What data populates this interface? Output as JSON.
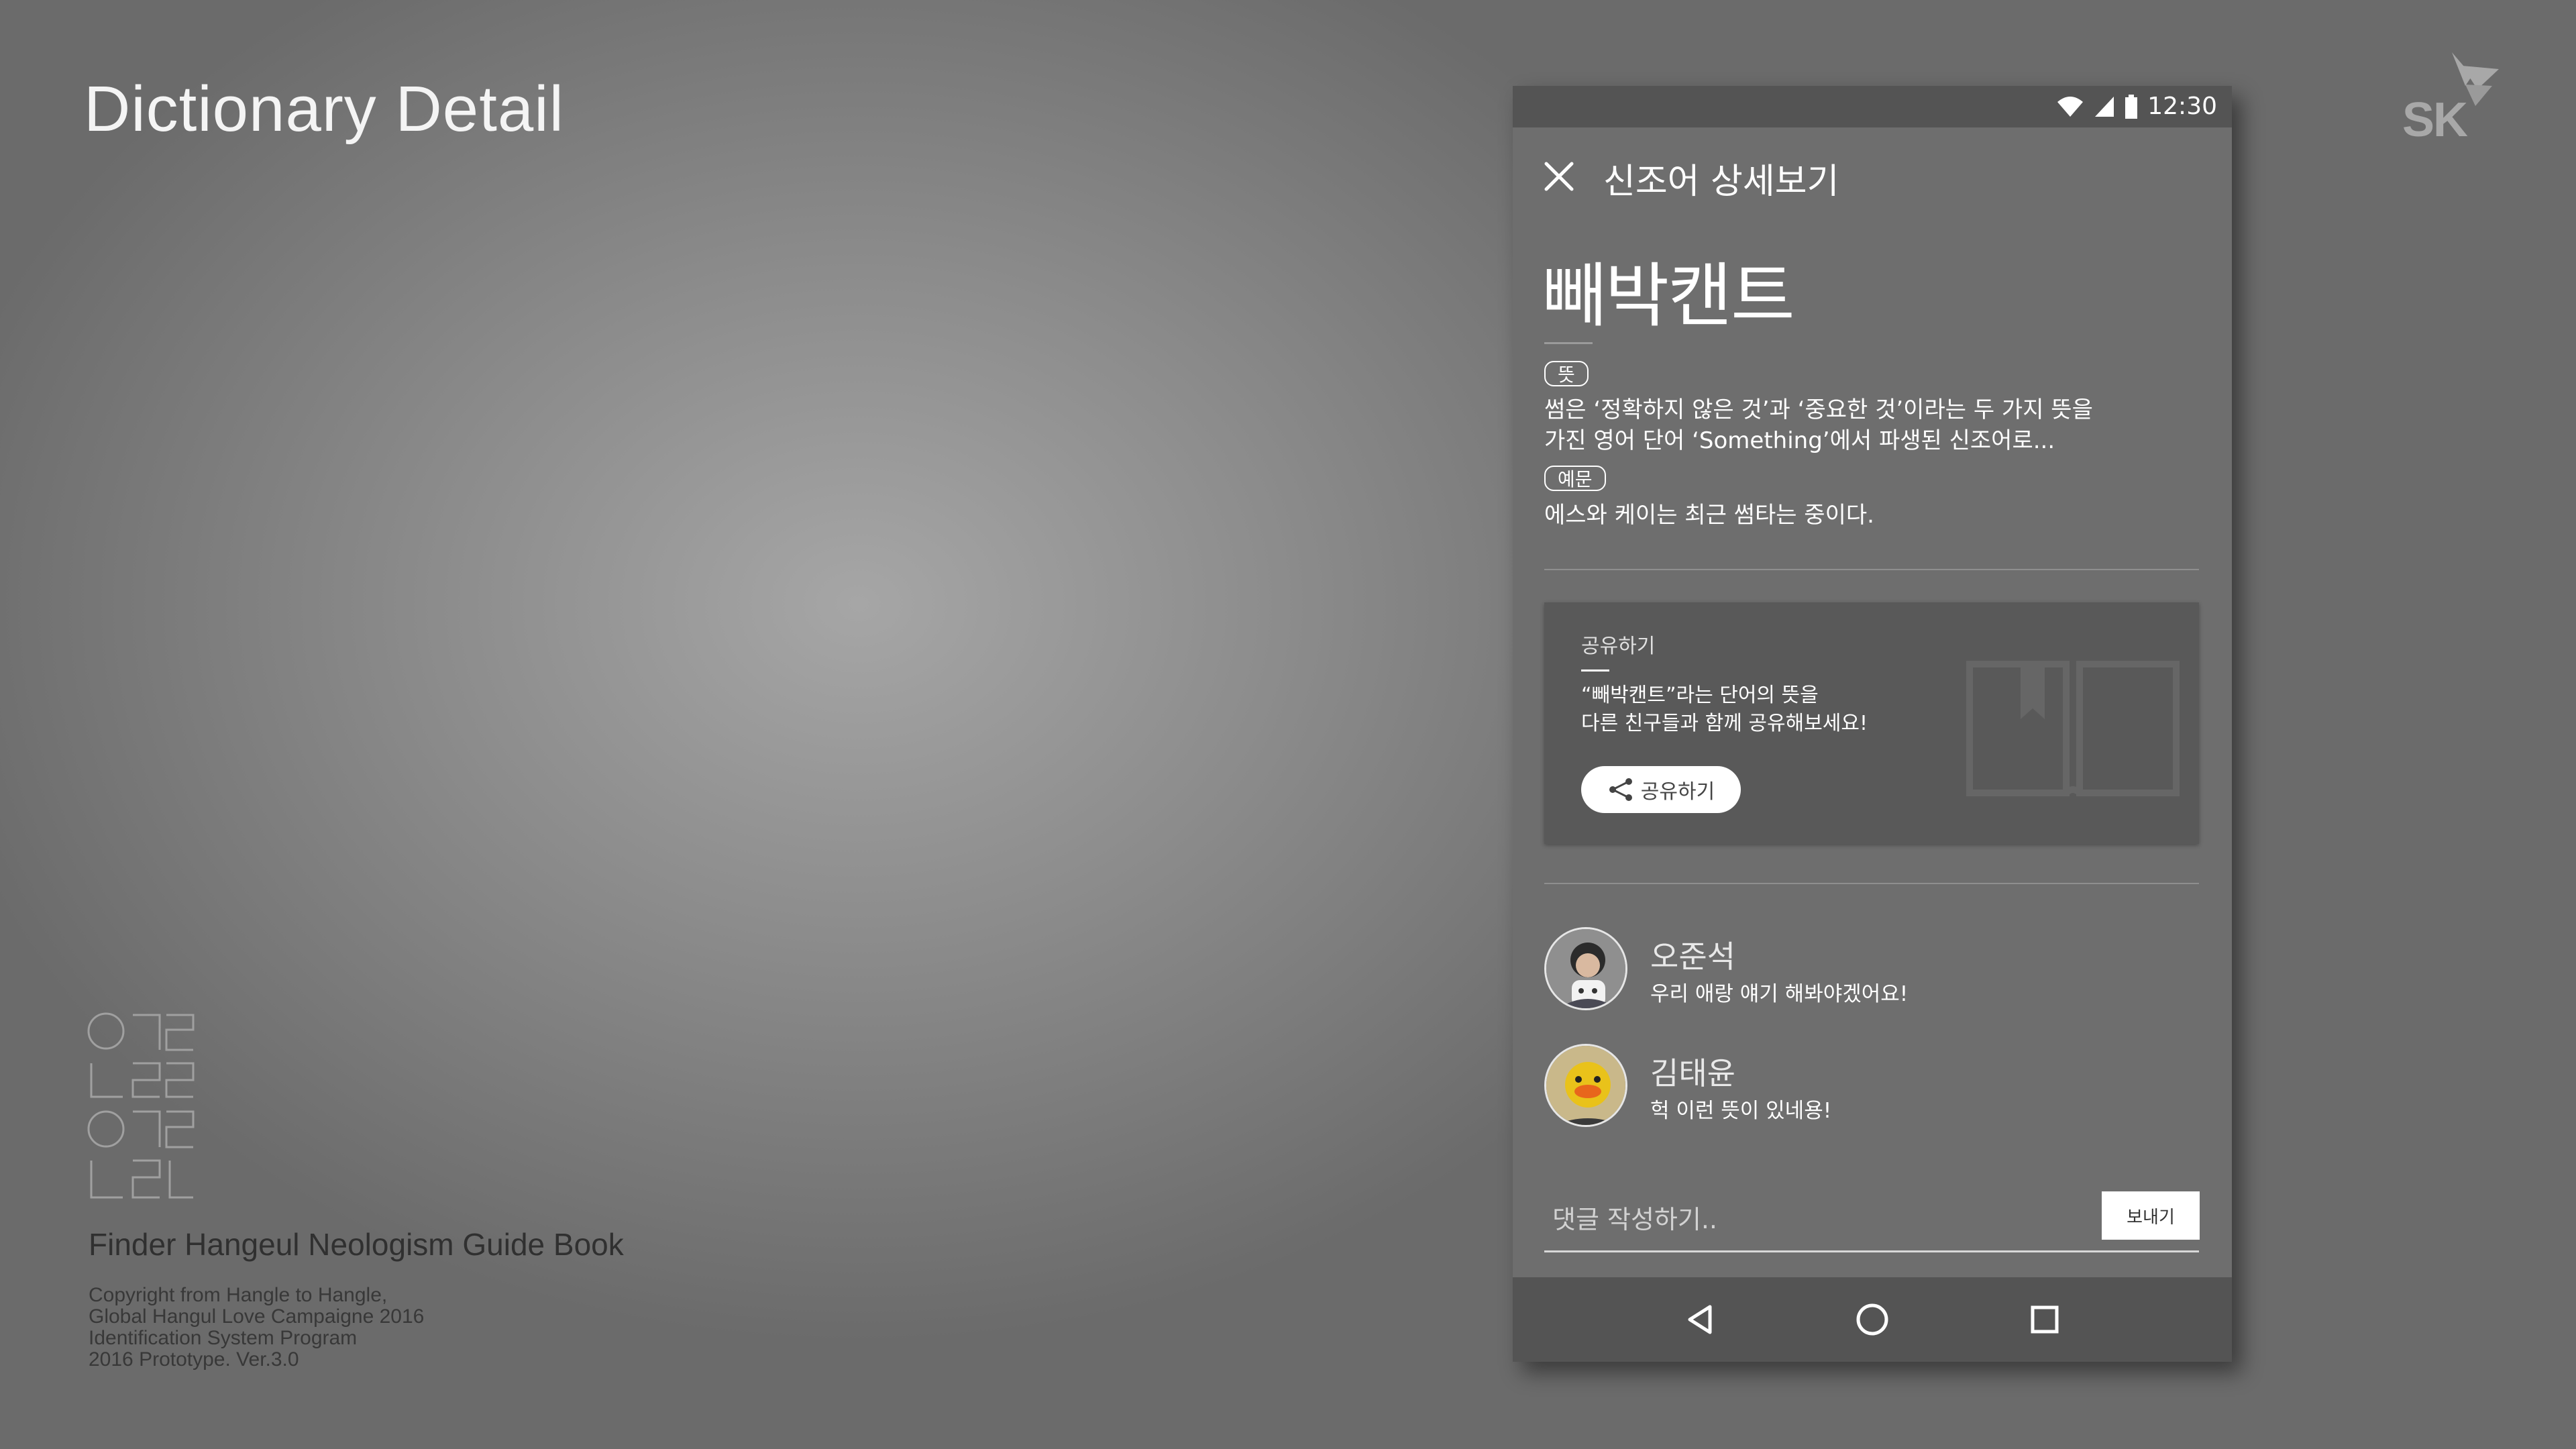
{
  "page": {
    "title": "Dictionary Detail",
    "brand": "SK",
    "book_title": "Finder Hangeul Neologism Guide Book",
    "copyright_lines": [
      "Copyright from Hangle to Hangle,",
      "Global Hangul Love Campaigne 2016",
      "Identification System Program",
      "2016 Prototype. Ver.3.0"
    ],
    "hangul_logo": "한글 한글"
  },
  "phone": {
    "status": {
      "time": "12:30",
      "icons": [
        "wifi-icon",
        "signal-icon",
        "battery-icon"
      ]
    },
    "header": {
      "title": "신조어 상세보기",
      "close_icon": "close-icon"
    },
    "entry": {
      "word": "빼박캔트",
      "meaning_tag": "뜻",
      "meaning_lines": [
        "썸은 ‘정확하지 않은 것’과 ‘중요한 것’이라는 두 가지 뜻을",
        "가진 영어 단어 ‘Something’에서 파생된 신조어로..."
      ],
      "example_tag": "예문",
      "example": "에스와 케이는 최근 썸타는 중이다."
    },
    "share": {
      "label": "공유하기",
      "message_lines": [
        "“빼박캔트”라는 단어의 뜻을",
        "다른 친구들과 함께 공유해보세요!"
      ],
      "button_label": "공유하기",
      "icon": "share-icon"
    },
    "comments": [
      {
        "name": "오준석",
        "text": "우리 애랑 얘기 해봐야겠어요!"
      },
      {
        "name": "김태윤",
        "text": "헉 이런 뜻이 있네용!"
      }
    ],
    "comment_input": {
      "placeholder": "댓글 작성하기..",
      "value": "",
      "send_label": "보내기"
    },
    "nav": [
      "back-icon",
      "home-icon",
      "recents-icon"
    ]
  },
  "colors": {
    "phone_background": "#6e6e6e",
    "bar_background": "#545454",
    "card_background": "#595959"
  }
}
